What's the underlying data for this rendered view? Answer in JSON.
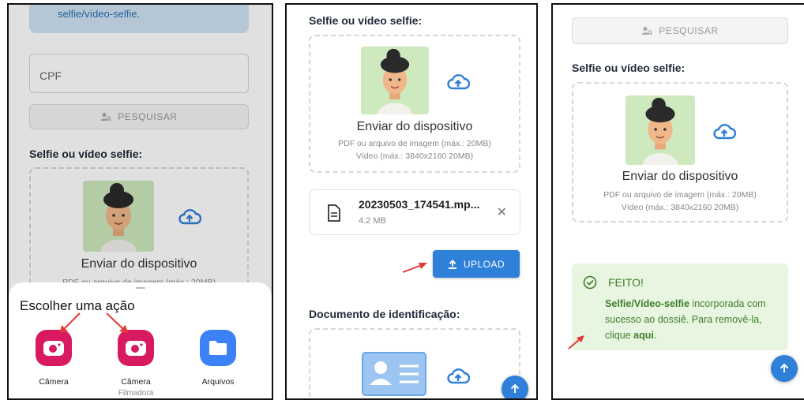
{
  "panel1": {
    "banner_text": "selfie/vídeo-selfie.",
    "cpf_placeholder": "CPF",
    "search_label": "PESQUISAR",
    "section_title": "Selfie ou vídeo selfie:",
    "dropzone_title": "Enviar do dispositivo",
    "dropzone_hint_partial": "PDF ou arquivo de imagem (máx.: 20MB)",
    "sheet": {
      "title": "Escolher uma ação",
      "apps": [
        {
          "label": "Câmera",
          "sub": "",
          "icon": "camera-icon",
          "color": "#d81b60"
        },
        {
          "label": "Câmera",
          "sub": "Filmadora",
          "icon": "camera-icon",
          "color": "#d81b60"
        },
        {
          "label": "Arquivos",
          "sub": "",
          "icon": "folder-icon",
          "color": "#3b82f6"
        }
      ]
    }
  },
  "panel2": {
    "section_title": "Selfie ou vídeo selfie:",
    "dropzone_title": "Enviar do dispositivo",
    "hint_line1": "PDF ou arquivo de imagem (máx.: 20MB)",
    "hint_line2": "Vídeo (máx.: 3840x2160 20MB)",
    "file_name": "20230503_174541.mp...",
    "file_size": "4.2 MB",
    "upload_label": "UPLOAD",
    "doc_section_title": "Documento de identificação:"
  },
  "panel3": {
    "search_label": "PESQUISAR",
    "section_title": "Selfie ou vídeo selfie:",
    "dropzone_title": "Enviar do dispositivo",
    "hint_line1": "PDF ou arquivo de imagem (máx.: 20MB)",
    "hint_line2": "Vídeo (máx.: 3840x2160 20MB)",
    "success_title": "FEITO!",
    "success_bold": "Selfie/Vídeo-selfie",
    "success_text": " incorporada com sucesso ao dossiê. Para removê-la, clique ",
    "success_link": "aqui",
    "success_end": "."
  },
  "colors": {
    "primary": "#2f80d8",
    "success_bg": "#e8f5e0",
    "success_text": "#3f7f2c",
    "camera_app": "#d81b60",
    "files_app": "#3b82f6",
    "annotation_arrow": "#e53935"
  }
}
